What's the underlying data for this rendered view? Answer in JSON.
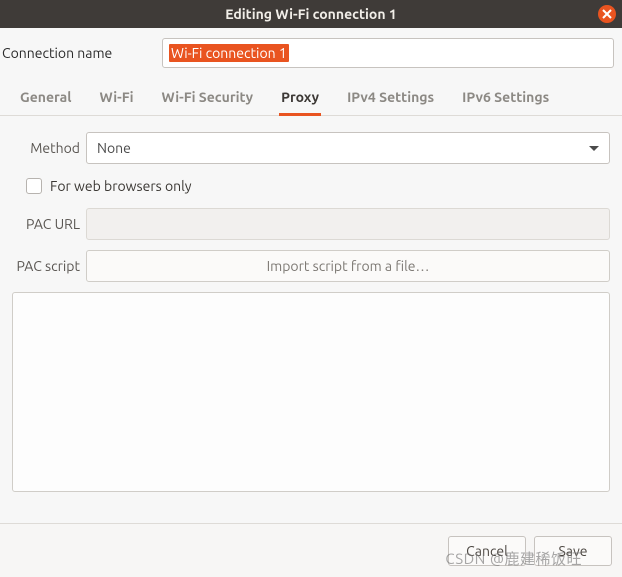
{
  "window": {
    "title": "Editing Wi-Fi connection 1"
  },
  "connection": {
    "name_label": "Connection name",
    "name_value": "Wi-Fi connection 1"
  },
  "tabs": {
    "general": "General",
    "wifi": "Wi-Fi",
    "security": "Wi-Fi Security",
    "proxy": "Proxy",
    "ipv4": "IPv4 Settings",
    "ipv6": "IPv6 Settings",
    "active": "proxy"
  },
  "proxy": {
    "method_label": "Method",
    "method_value": "None",
    "browsers_only_label": "For web browsers only",
    "browsers_only_checked": false,
    "pac_url_label": "PAC URL",
    "pac_url_value": "",
    "pac_script_label": "PAC script",
    "import_button": "Import script from a file…"
  },
  "footer": {
    "cancel": "Cancel",
    "save": "Save"
  },
  "watermark": "CSDN @鹿建稀饭旺"
}
